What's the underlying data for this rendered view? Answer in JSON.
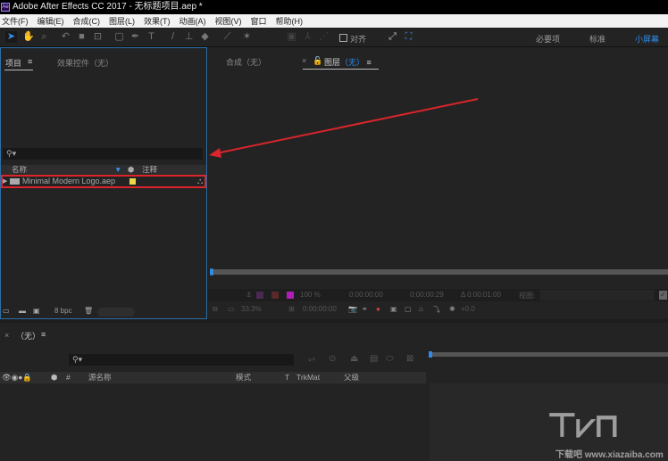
{
  "title": "Adobe After Effects CC 2017 - 无标题项目.aep *",
  "app_icon": "Ae",
  "menu": [
    "文件(F)",
    "编辑(E)",
    "合成(C)",
    "图层(L)",
    "效果(T)",
    "动画(A)",
    "视图(V)",
    "窗口",
    "帮助(H)"
  ],
  "toolbar": {
    "snap_label": "对齐",
    "workspaces": [
      "必要项",
      "标准",
      "小屏幕"
    ],
    "active_workspace_color": "#2d8ceb"
  },
  "project_panel": {
    "tab_project": "项目",
    "tab_effects": "效果控件（无）",
    "search_placeholder": "",
    "columns": {
      "name": "名称",
      "comment": "注释"
    },
    "items": [
      {
        "name": "Minimal Modern Logo.aep",
        "label_color": "#e8d84a"
      }
    ],
    "bpc": "8 bpc"
  },
  "viewer": {
    "tab_comp": "合成（无）",
    "tab_layer_prefix": "图层",
    "tab_layer_value": "（无）",
    "zoom": "100 %",
    "time_start": "0:00:00:00",
    "time_end": "0:00:00:29",
    "duration": "Δ 0:00:01:00",
    "view_label": "视图:",
    "mag": "33.3%",
    "current_time": "0:00:00:00",
    "exposure": "+0.0"
  },
  "timeline": {
    "tab": "（无）",
    "columns": {
      "num": "#",
      "source": "源名称",
      "mode": "模式",
      "t": "T",
      "trkmat": "TrkMat",
      "parent": "父级"
    }
  },
  "watermark": "下载吧 www.xiazaiba.com",
  "annotation_color": "#d9252b"
}
